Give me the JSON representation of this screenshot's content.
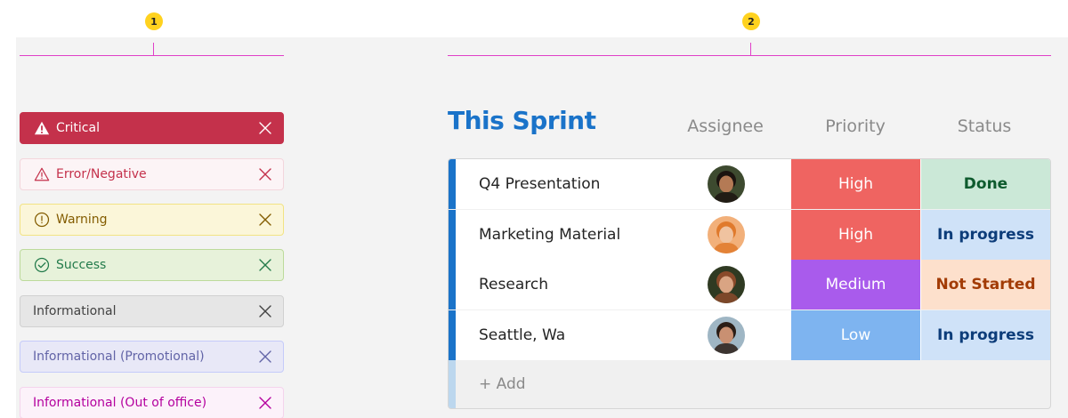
{
  "markers": [
    "1",
    "2"
  ],
  "notification_bars": [
    {
      "label": "Critical",
      "icon": "warning-filled-icon",
      "bg": "#c4314b",
      "border": "#c4314b",
      "text": "#ffffff"
    },
    {
      "label": "Error/Negative",
      "icon": "warning-outline-icon",
      "bg": "#fcf4f6",
      "border": "#f3d6dc",
      "text": "#c4314b"
    },
    {
      "label": "Warning",
      "icon": "exclamation-circle-icon",
      "bg": "#fbf6d9",
      "border": "#f2e384",
      "text": "#835c00"
    },
    {
      "label": "Success",
      "icon": "checkmark-circle-icon",
      "bg": "#e7f2da",
      "border": "#bdda9b",
      "text": "#237b4b"
    },
    {
      "label": "Informational",
      "icon": "",
      "bg": "#e6e6e6",
      "border": "#d1d1d1",
      "text": "#424242"
    },
    {
      "label": "Informational (Promotional)",
      "icon": "",
      "bg": "#e8e8f7",
      "border": "#c5cbfa",
      "text": "#6264a7"
    },
    {
      "label": "Informational (Out of office)",
      "icon": "",
      "bg": "#fcf2fa",
      "border": "#f4d4ec",
      "text": "#b4009e"
    }
  ],
  "board": {
    "title": "This Sprint",
    "columns": {
      "assignee": "Assignee",
      "priority": "Priority",
      "status": "Status"
    },
    "rows": [
      {
        "item": "Q4 Presentation",
        "avatar": "avatar-person-1",
        "priority": "High",
        "priority_color": "#ef6461",
        "status": "Done",
        "status_bg": "#cbe8d7",
        "status_text": "#0e5b2e"
      },
      {
        "item": "Marketing Material",
        "avatar": "avatar-person-2",
        "priority": "High",
        "priority_color": "#ef6461",
        "status": "In progress",
        "status_bg": "#cfe2f8",
        "status_text": "#0d3d7a"
      },
      {
        "item": "Research",
        "avatar": "avatar-person-3",
        "priority": "Medium",
        "priority_color": "#a95bec",
        "status": "Not Started",
        "status_bg": "#fde0cc",
        "status_text": "#a23b05"
      },
      {
        "item": "Seattle, Wa",
        "avatar": "avatar-person-4",
        "priority": "Low",
        "priority_color": "#7eb4f0",
        "status": "In progress",
        "status_bg": "#cfe2f8",
        "status_text": "#0d3d7a"
      }
    ],
    "add_label": "+ Add"
  }
}
